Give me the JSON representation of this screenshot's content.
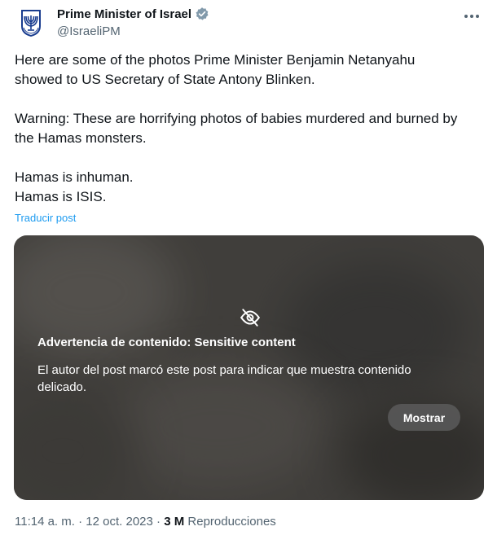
{
  "author": {
    "display_name": "Prime Minister of Israel",
    "handle": "@IsraeliPM",
    "avatar_icon": "menorah-emblem-icon",
    "verified_badge_color": "#829aab"
  },
  "tweet": {
    "paragraphs": [
      [
        "Here are some of the photos Prime Minister Benjamin Netanyahu",
        "showed to US Secretary of State Antony Blinken."
      ],
      [
        "Warning: These are horrifying photos of babies murdered and burned by",
        "the Hamas monsters."
      ],
      [
        "Hamas is inhuman.",
        "Hamas is ISIS."
      ]
    ],
    "translate_link": "Traducir post"
  },
  "media": {
    "warning_icon": "eye-slash-icon",
    "warning_title": "Advertencia de contenido: Sensitive content",
    "warning_desc": [
      "El autor del post marcó este post para indicar que muestra contenido",
      "delicado."
    ],
    "show_button": "Mostrar"
  },
  "meta": {
    "time": "11:14 a. m.",
    "separator1": "·",
    "date": "12 oct. 2023",
    "separator2": "·",
    "views_count": "3 M",
    "views_label": "Reproducciones"
  },
  "colors": {
    "link": "#1d9bf0",
    "secondary_text": "#536471",
    "primary_text": "#0f1419"
  }
}
